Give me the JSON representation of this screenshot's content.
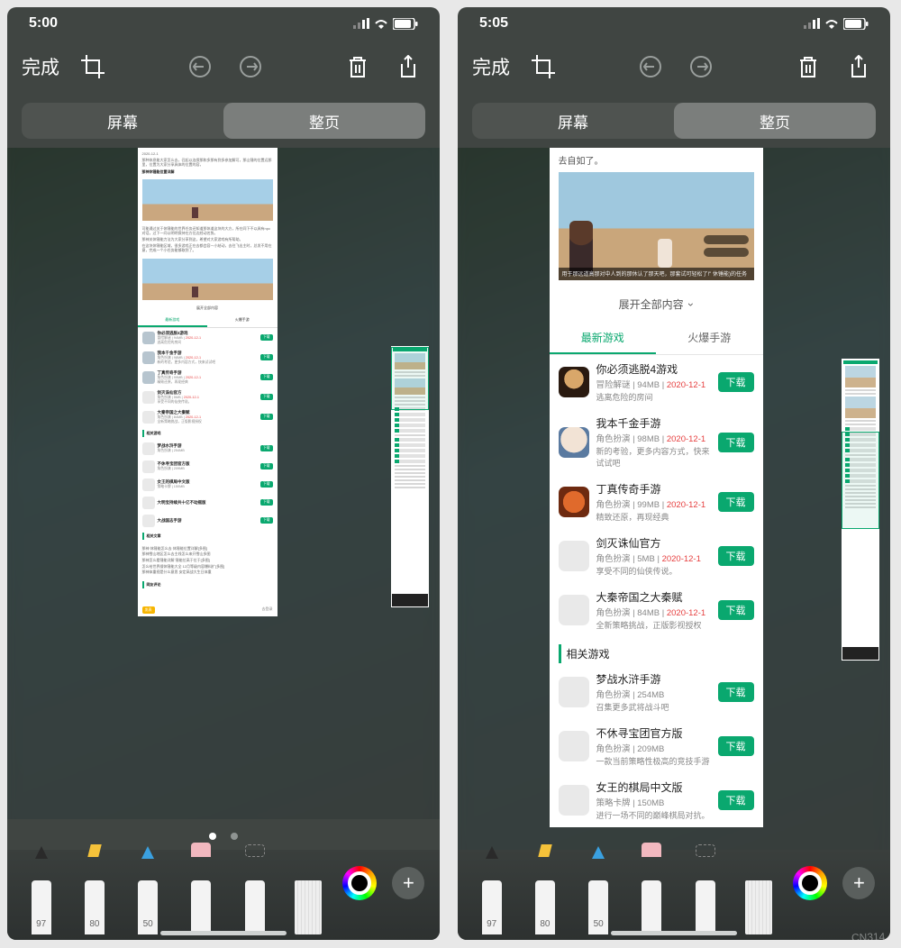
{
  "left": {
    "status": {
      "time": "5:00"
    },
    "toolbar": {
      "done": "完成"
    },
    "segment": {
      "screen": "屏幕",
      "full": "整页"
    },
    "expand": "展开全部内容",
    "tabs": {
      "latest": "最新游戏",
      "hot": "火爆手游"
    },
    "games": [
      {
        "title": "你必须逃脱4游戏",
        "cat": "冒险解谜",
        "size": "94MB",
        "date": "2020-12-1",
        "desc": "逃离危险的房间",
        "dl": "下载"
      },
      {
        "title": "我本千金手游",
        "cat": "角色扮演",
        "size": "98MB",
        "date": "2020-12-1",
        "desc": "新的考验，更多内容方式，快来试试吧",
        "dl": "下载"
      },
      {
        "title": "丁真传奇手游",
        "cat": "角色扮演",
        "size": "99MB",
        "date": "2020-12-1",
        "desc": "精致还原，再现经典",
        "dl": "下载"
      },
      {
        "title": "剑灭诛仙官方",
        "cat": "角色扮演",
        "size": "5MB",
        "date": "2020-12-1",
        "desc": "享受不同的仙侠传说。",
        "dl": "下载"
      },
      {
        "title": "大秦帝国之大秦赋",
        "cat": "角色扮演",
        "size": "84MB",
        "date": "2020-12-1",
        "desc": "全新策略挑战，正版影视授权",
        "dl": "下载"
      }
    ],
    "relatedHeader": "相关游戏",
    "related": [
      {
        "title": "梦战水浒手游",
        "cat": "角色扮演",
        "size": "254MB",
        "desc": "召集更多武将战斗吧",
        "dl": "下载"
      },
      {
        "title": "不休寻宝团官方版",
        "cat": "角色扮演",
        "size": "209MB",
        "desc": "一款当前策略性极高的竞技手游",
        "dl": "下载"
      },
      {
        "title": "女王的棋局中文版",
        "cat": "策略卡牌",
        "size": "150MB",
        "desc": "进行一场不同的巅峰棋局对抗。",
        "dl": "下载"
      },
      {
        "title": "大明宝持续共十亿不动摇版",
        "cat": "",
        "size": "",
        "desc": "",
        "dl": "下载"
      },
      {
        "title": "大战国志手游",
        "cat": "",
        "size": "",
        "desc": "",
        "dl": "下载"
      }
    ],
    "articlesHeader": "相关文章",
    "commentsHeader": "网友评论",
    "commentBar": {
      "publish": "发表",
      "login": "去登录"
    }
  },
  "right": {
    "status": {
      "time": "5:05"
    },
    "toolbar": {
      "done": "完成"
    },
    "segment": {
      "screen": "屏幕",
      "full": "整页"
    },
    "intro": "去自如了。",
    "expand": "展开全部内容",
    "tabs": {
      "latest": "最新游戏",
      "hot": "火爆手游"
    },
    "games": [
      {
        "title": "你必须逃脱4游戏",
        "cat": "冒险解谜",
        "size": "94MB",
        "date": "2020-12-1",
        "desc": "逃离危险的房间",
        "dl": "下载"
      },
      {
        "title": "我本千金手游",
        "cat": "角色扮演",
        "size": "98MB",
        "date": "2020-12-1",
        "desc": "新的考验，更多内容方式，快来试试吧",
        "dl": "下载"
      },
      {
        "title": "丁真传奇手游",
        "cat": "角色扮演",
        "size": "99MB",
        "date": "2020-12-1",
        "desc": "精致还原，再现经典",
        "dl": "下载"
      },
      {
        "title": "剑灭诛仙官方",
        "cat": "角色扮演",
        "size": "5MB",
        "date": "2020-12-1",
        "desc": "享受不同的仙侠传说。",
        "dl": "下载"
      },
      {
        "title": "大秦帝国之大秦赋",
        "cat": "角色扮演",
        "size": "84MB",
        "date": "2020-12-1",
        "desc": "全新策略挑战，正版影视授权",
        "dl": "下载"
      }
    ],
    "relatedHeader": "相关游戏",
    "related": [
      {
        "title": "梦战水浒手游",
        "cat": "角色扮演",
        "size": "254MB",
        "desc": "召集更多武将战斗吧",
        "dl": "下载"
      },
      {
        "title": "不休寻宝团官方版",
        "cat": "角色扮演",
        "size": "209MB",
        "desc": "一款当前策略性极高的竞技手游",
        "dl": "下载"
      },
      {
        "title": "女王的棋局中文版",
        "cat": "策略卡牌",
        "size": "150MB",
        "desc": "进行一场不同的巅峰棋局对抗。",
        "dl": "下载"
      }
    ]
  },
  "tools": {
    "pen": "97",
    "marker": "80",
    "pencil": "50"
  }
}
